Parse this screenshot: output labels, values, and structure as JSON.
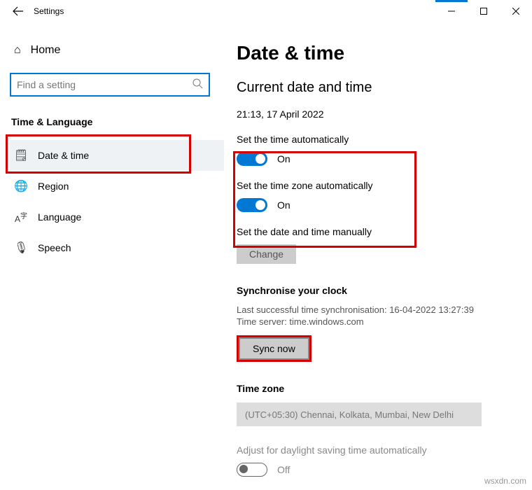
{
  "window": {
    "title": "Settings"
  },
  "home": {
    "label": "Home"
  },
  "search": {
    "placeholder": "Find a setting"
  },
  "section": {
    "title": "Time & Language"
  },
  "nav": {
    "items": [
      {
        "label": "Date & time",
        "icon": "🗓"
      },
      {
        "label": "Region",
        "icon": "🌐"
      },
      {
        "label": "Language",
        "icon": "A字"
      },
      {
        "label": "Speech",
        "icon": "🎤"
      }
    ]
  },
  "page": {
    "title": "Date & time",
    "subtitle": "Current date and time",
    "current": "21:13, 17 April 2022",
    "auto_time": {
      "label": "Set the time automatically",
      "state": "On"
    },
    "auto_tz": {
      "label": "Set the time zone automatically",
      "state": "On"
    },
    "manual": {
      "label": "Set the date and time manually",
      "button": "Change"
    },
    "sync": {
      "heading": "Synchronise your clock",
      "last": "Last successful time synchronisation: 16-04-2022 13:27:39",
      "server": "Time server: time.windows.com",
      "button": "Sync now"
    },
    "timezone": {
      "heading": "Time zone",
      "value": "(UTC+05:30) Chennai, Kolkata, Mumbai, New Delhi"
    },
    "dst": {
      "label": "Adjust for daylight saving time automatically",
      "state": "Off"
    }
  },
  "watermark": "wsxdn.com"
}
